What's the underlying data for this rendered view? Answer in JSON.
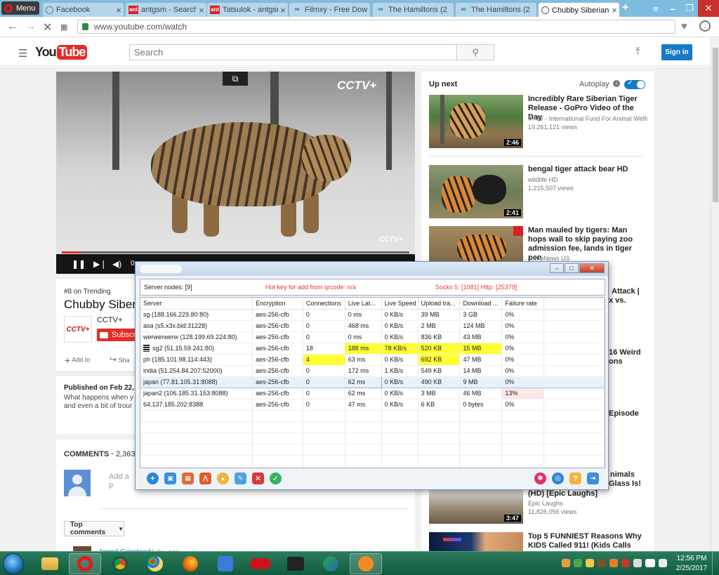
{
  "browser": {
    "menu_label": "Menu",
    "tabs": [
      {
        "label": "Facebook",
        "icon": "facebook-icon"
      },
      {
        "label": "antgsm - Search F",
        "icon": "antgsm-icon"
      },
      {
        "label": "Tatsulok - antgsm",
        "icon": "antgsm-icon"
      },
      {
        "label": "Filmxy - Free Dow",
        "icon": "filmxy-icon"
      },
      {
        "label": "The Hamiltons (2",
        "icon": "filmxy-icon"
      },
      {
        "label": "The Hamiltons (2",
        "icon": "filmxy-icon"
      },
      {
        "label": "Chubby Siberian T",
        "icon": "chrome-icon",
        "active": true
      }
    ],
    "url": "www.youtube.com/watch"
  },
  "youtube": {
    "logo_you": "You",
    "logo_tube": "Tube",
    "search_placeholder": "Search",
    "signin_label": "Sign in",
    "video": {
      "trending": "#8 on Trending",
      "title": "Chubby Siberia",
      "channel": "CCTV+",
      "subscribe_label": "Subscri",
      "add_to": "Add to",
      "share": "Sha",
      "published": "Published on Feb 22,",
      "desc_line1": "What happens when y",
      "desc_line2": "and even a bit of trour",
      "watermark": "CCTV+",
      "watermark_small": "CCTV+",
      "time": "0:"
    },
    "comments": {
      "label": "COMMENTS",
      "count": "2,363",
      "input_placeholder": "Add a p",
      "sort_label": "Top comments",
      "first_commenter": "Jerrad Grinstead",
      "first_time": "1 day ago"
    },
    "sidebar": {
      "up_next": "Up next",
      "autoplay": "Autoplay",
      "items": [
        {
          "title": "Incredibly Rare Siberian Tiger Release - GoPro Video of the Day",
          "channel": "IFAW - International Fund For Animal Welfare",
          "views": "19,261,121 views",
          "duration": "2:46"
        },
        {
          "title": "bengal tiger attack bear HD",
          "channel": "wildlife HD",
          "views": "1,215,507 views",
          "duration": "2:41"
        },
        {
          "title": "Man mauled by tigers: Man hops wall to skip paying zoo admission fee, lands in tiger pen",
          "channel": "TomoNews US",
          "views": "",
          "duration": ""
        }
      ],
      "clipped": [
        "Attack |",
        "x vs.",
        "16 Weird",
        "ons",
        "Episode",
        "nimals",
        "Glass Is!"
      ],
      "item4": {
        "title": "(HD) [Epic Laughs]",
        "channel": "Epic Laughs",
        "views": "11,826,056 views",
        "duration": "3:47"
      },
      "item5": {
        "title": "Top 5 FUNNIEST Reasons Why KIDS Called 911! (Kids Calls"
      }
    }
  },
  "proxy": {
    "server_nodes": "Server nodes: [9]",
    "hotkey": "Hot key for add from qrcode: n/a",
    "socks": "Socks 5: [1081] Http: [25379]",
    "columns": [
      "Server",
      "Encryption",
      "Connections",
      "Live Lat...",
      "Live Speed",
      "Upload tra...",
      "Download ...",
      "Failure rate"
    ],
    "rows": [
      {
        "server": "sg (188.166.229.80:80)",
        "enc": "aes-256-cfb",
        "conn": "0",
        "lat": "0 ms",
        "speed": "0 KB/s",
        "up": "39 MB",
        "down": "3 GB",
        "fail": "0%"
      },
      {
        "server": "asa (s5.x3x.bid:31228)",
        "enc": "aes-256-cfb",
        "conn": "0",
        "lat": "468 ms",
        "speed": "0 KB/s",
        "up": "2 MB",
        "down": "124 MB",
        "fail": "0%"
      },
      {
        "server": "werwerwerw (128.199.69.224:80)",
        "enc": "aes-256-cfb",
        "conn": "0",
        "lat": "0 ms",
        "speed": "0 KB/s",
        "up": "836 KB",
        "down": "43 MB",
        "fail": "0%"
      },
      {
        "server": "sg2 (51.15.59.241:80)",
        "enc": "aes-256-cfb",
        "conn": "18",
        "lat": "188 ms",
        "speed": "78 KB/s",
        "up": "520 KB",
        "down": "15 MB",
        "fail": "0%",
        "active": true
      },
      {
        "server": "ph (185.101.98.114:443)",
        "enc": "aes-256-cfb",
        "conn": "4",
        "lat": "63 ms",
        "speed": "0 KB/s",
        "up": "692 KB",
        "down": "47 MB",
        "fail": "0%"
      },
      {
        "server": "india (51.254.84.207:52000)",
        "enc": "aes-256-cfb",
        "conn": "0",
        "lat": "172 ms",
        "speed": "1 KB/s",
        "up": "549 KB",
        "down": "14 MB",
        "fail": "0%"
      },
      {
        "server": "japan (77.81.105.31:8088)",
        "enc": "aes-256-cfb",
        "conn": "0",
        "lat": "62 ms",
        "speed": "0 KB/s",
        "up": "490 KB",
        "down": "9 MB",
        "fail": "0%",
        "selected": true
      },
      {
        "server": "japan2 (106.185.31.153:8088)",
        "enc": "aes-256-cfb",
        "conn": "0",
        "lat": "62 ms",
        "speed": "0 KB/s",
        "up": "3 MB",
        "down": "46 MB",
        "fail": "13%"
      },
      {
        "server": "64.137.185.202:8388",
        "enc": "aes-256-cfb",
        "conn": "0",
        "lat": "47 ms",
        "speed": "0 KB/s",
        "up": "6 KB",
        "down": "0 bytes",
        "fail": "0%"
      }
    ],
    "highlight_color": "#ffff33",
    "warning_color": "#e53935"
  },
  "taskbar": {
    "time": "12:56 PM",
    "date": "2/25/2017"
  }
}
